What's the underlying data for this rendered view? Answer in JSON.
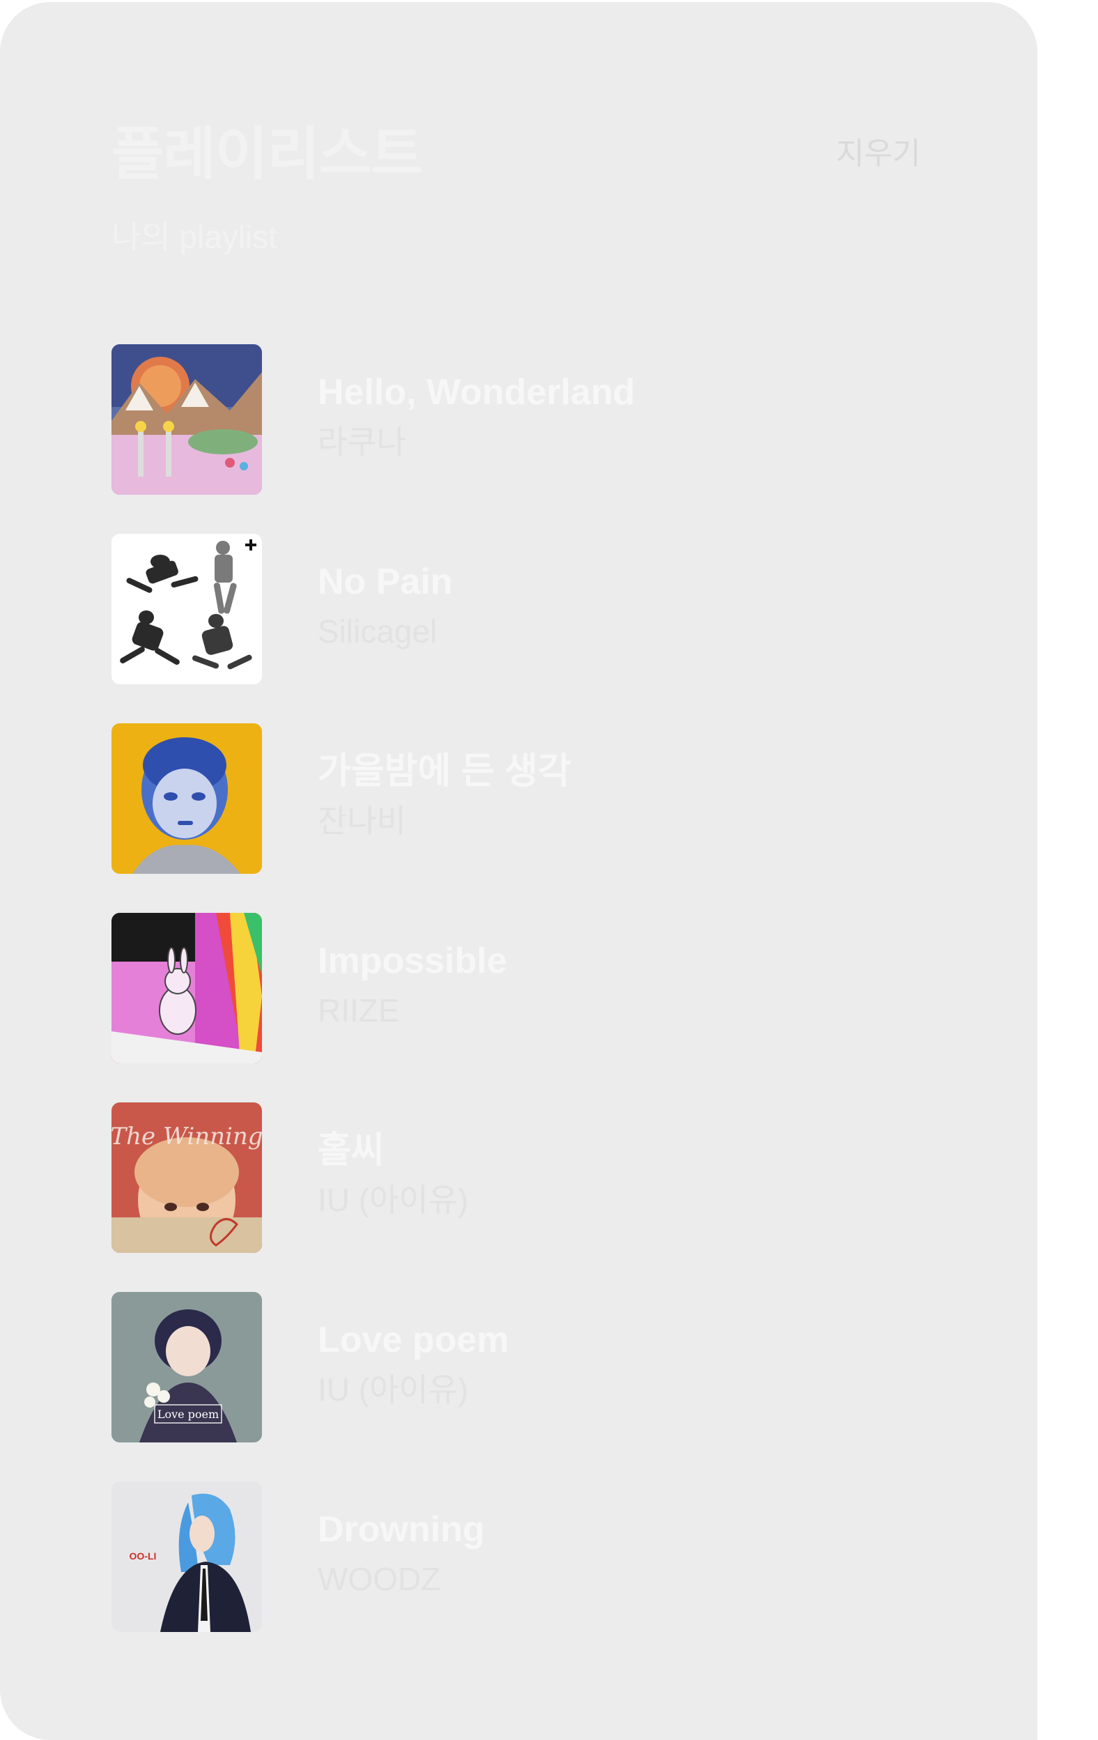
{
  "header": {
    "title": "플레이리스트",
    "subtitle": "나의 playlist",
    "clear_label": "지우기"
  },
  "tracks": [
    {
      "title": "Hello, Wonderland",
      "artist": "라쿠나"
    },
    {
      "title": "No Pain",
      "artist": "Silicagel"
    },
    {
      "title": "가을밤에 든 생각",
      "artist": "잔나비"
    },
    {
      "title": "Impossible",
      "artist": "RIIZE"
    },
    {
      "title": "홀씨",
      "artist": "IU (아이유)",
      "cover_text": "The Winning"
    },
    {
      "title": "Love poem",
      "artist": "IU (아이유)",
      "cover_text": "Love poem"
    },
    {
      "title": "Drowning",
      "artist": "WOODZ",
      "cover_text": "OO-LI"
    }
  ],
  "colors": {
    "panel_bg": "#ececec",
    "title_text": "#f2f2f2",
    "track_title": "#f7f7f7",
    "track_artist": "#e2e2e2",
    "clear_text": "#dadada"
  }
}
